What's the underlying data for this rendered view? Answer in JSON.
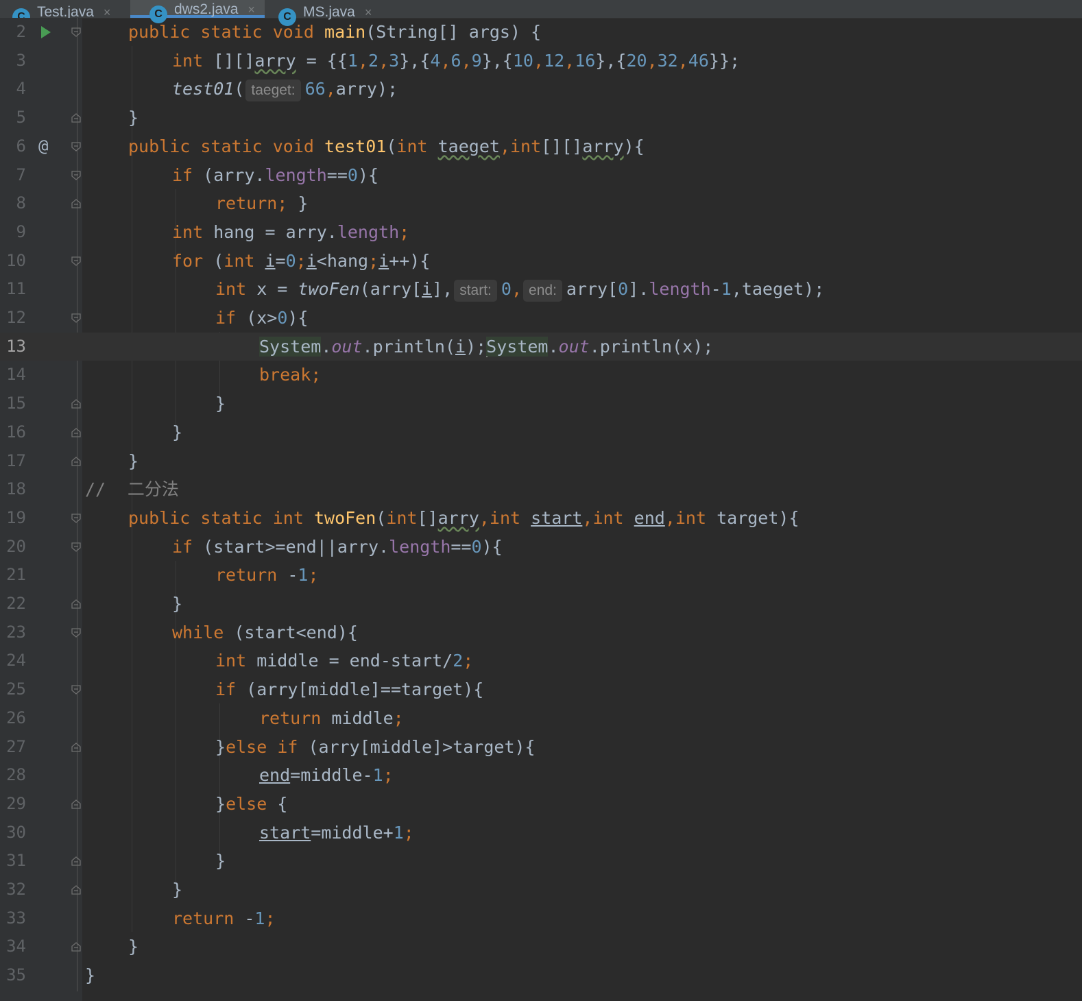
{
  "tabs": [
    {
      "name": "Test.java",
      "active": false
    },
    {
      "name": "dws2.java",
      "active": true
    },
    {
      "name": "MS.java",
      "active": false
    }
  ],
  "tab_icon_letter": "C",
  "current_line": 13,
  "lines": [
    {
      "n": "2"
    },
    {
      "n": "3"
    },
    {
      "n": "4"
    },
    {
      "n": "5"
    },
    {
      "n": "6"
    },
    {
      "n": "7"
    },
    {
      "n": "8"
    },
    {
      "n": "9"
    },
    {
      "n": "10"
    },
    {
      "n": "11"
    },
    {
      "n": "12"
    },
    {
      "n": "13"
    },
    {
      "n": "14"
    },
    {
      "n": "15"
    },
    {
      "n": "16"
    },
    {
      "n": "17"
    },
    {
      "n": "18"
    },
    {
      "n": "19"
    },
    {
      "n": "20"
    },
    {
      "n": "21"
    },
    {
      "n": "22"
    },
    {
      "n": "23"
    },
    {
      "n": "24"
    },
    {
      "n": "25"
    },
    {
      "n": "26"
    },
    {
      "n": "27"
    },
    {
      "n": "28"
    },
    {
      "n": "29"
    },
    {
      "n": "30"
    },
    {
      "n": "31"
    },
    {
      "n": "32"
    },
    {
      "n": "33"
    },
    {
      "n": "34"
    },
    {
      "n": "35"
    }
  ],
  "code": {
    "l2": {
      "public": "public",
      "static": "static",
      "void": "void",
      "main": "main",
      "rest": "(String[] args) {"
    },
    "l3": {
      "int": "int",
      "a": " [][]",
      "arry": "arry",
      "b": " = {{",
      "n1": "1",
      "c1": ",",
      "n2": "2",
      "c2": ",",
      "n3": "3",
      "c3": "},{",
      "n4": "4",
      "c4": ",",
      "n5": "6",
      "c5": ",",
      "n6": "9",
      "c6": "},{",
      "n7": "10",
      "c7": ",",
      "n8": "12",
      "c8": ",",
      "n9": "16",
      "c9": "},{",
      "n10": "20",
      "c10": ",",
      "n11": "32",
      "c11": ",",
      "n12": "46",
      "end": "}};",
      "semi": ""
    },
    "l4": {
      "call": "test01",
      "open": "(",
      "hint": "taeget:",
      "n": "66",
      "comma": ",",
      "rest": "arry);"
    },
    "l5": {
      "brace": "}"
    },
    "l6": {
      "at": "@",
      "public": "public",
      "static": "static",
      "void": "void",
      "fn": "test01",
      "p1": "(",
      "int1": "int",
      "taeget": "taeget",
      "comma": ",",
      "int2": "int",
      "p2": "[][]",
      "arry": "arry",
      "p3": "){"
    },
    "l7": {
      "if": "if",
      "a": " (arry.",
      "length": "length",
      "b": "==",
      "n": "0",
      "c": "){"
    },
    "l8": {
      "ret": "return;",
      "b": " }"
    },
    "l9": {
      "int": "int",
      "a": " hang = arry.",
      "length": "length",
      "semi": ";"
    },
    "l10": {
      "for": "for",
      "a": " (",
      "int": "int",
      "sp": " ",
      "i1": "i",
      "eq": "=",
      "n0": "0",
      "s1": ";",
      "i2": "i",
      "lt": "<hang",
      "s2": ";",
      "i3": "i",
      "pp": "++){"
    },
    "l11": {
      "int": "int",
      "a": " x = ",
      "fn": "twoFen",
      "b": "(arry[",
      "i": "i",
      "c": "],",
      "hint1": "start:",
      "n0": "0",
      "c2": ",",
      "hint2": "end:",
      "d": "arry[",
      "n00": "0",
      "e": "].",
      "length": "length",
      "minus": "-",
      "n1": "1",
      "f": ",taeget);"
    },
    "l12": {
      "if": "if",
      "a": " (x>",
      "n": "0",
      "b": "){"
    },
    "l13": {
      "sys1": "System",
      "dot1": ".",
      "out1": "out",
      "a": ".println(",
      "i": "i",
      "b": ");",
      "sys2": "System",
      "dot2": ".",
      "out2": "out",
      "c": ".println(x);"
    },
    "l14": {
      "brk": "break;"
    },
    "l15": {
      "brace": "}"
    },
    "l16": {
      "brace": "}"
    },
    "l17": {
      "brace": "}"
    },
    "l18": {
      "cm": "//",
      "txt": "    二分法"
    },
    "l19": {
      "public": "public",
      "static": "static",
      "int": "int",
      "fn": "twoFen",
      "a": "(",
      "int1": "int",
      "b": "[]",
      "arry": "arry",
      "c1": ",",
      "int2": "int",
      "start": "start",
      "c2": ",",
      "int3": "int",
      "end": "end",
      "c3": ",",
      "int4": "int",
      "d": " target){"
    },
    "l20": {
      "if": "if",
      "a": " (start>=end||arry.",
      "length": "length",
      "b": "==",
      "n": "0",
      "c": "){"
    },
    "l21": {
      "ret": "return",
      "a": " -",
      "n": "1",
      "semi": ";"
    },
    "l22": {
      "brace": "}"
    },
    "l23": {
      "while": "while",
      "a": " (start<end){"
    },
    "l24": {
      "int": "int",
      "a": " middle = end-start/",
      "n": "2",
      "semi": ";"
    },
    "l25": {
      "if": "if",
      "a": " (arry[middle]==target){"
    },
    "l26": {
      "ret": "return",
      "a": " middle",
      "semi": ";"
    },
    "l27": {
      "a": "}",
      "els": "else if",
      "b": " (arry[middle]>target){"
    },
    "l28": {
      "end": "end",
      "a": "=middle-",
      "n": "1",
      "semi": ";"
    },
    "l29": {
      "a": "}",
      "els": "else",
      "b": " {"
    },
    "l30": {
      "start": "start",
      "a": "=middle+",
      "n": "1",
      "semi": ";"
    },
    "l31": {
      "brace": "}"
    },
    "l32": {
      "brace": "}"
    },
    "l33": {
      "ret": "return",
      "a": " -",
      "n": "1",
      "semi": ";"
    },
    "l34": {
      "brace": "}"
    },
    "l35": {
      "brace": "}"
    }
  }
}
